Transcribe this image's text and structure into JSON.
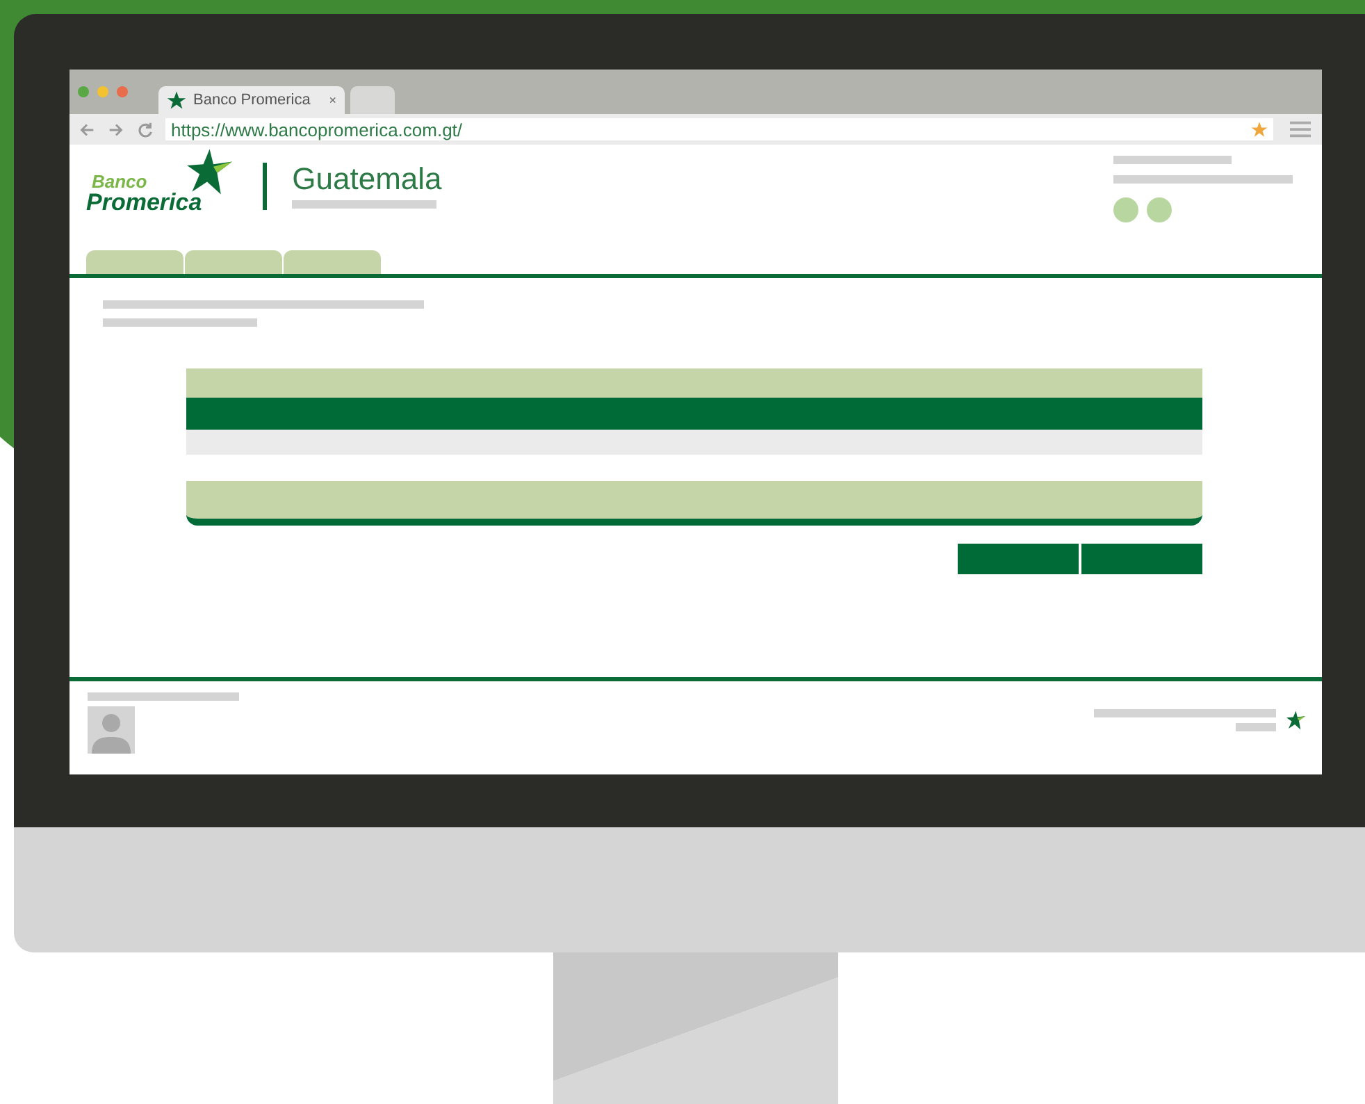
{
  "browser": {
    "tabs": [
      {
        "title": "Banco Promerica",
        "close": "×",
        "selected": true
      },
      {
        "selected": false
      }
    ],
    "url": "https://www.bancopromerica.com.gt/"
  },
  "site": {
    "logo": {
      "top": "Banco",
      "bottom": "Promerica"
    },
    "country": "Guatemala"
  }
}
